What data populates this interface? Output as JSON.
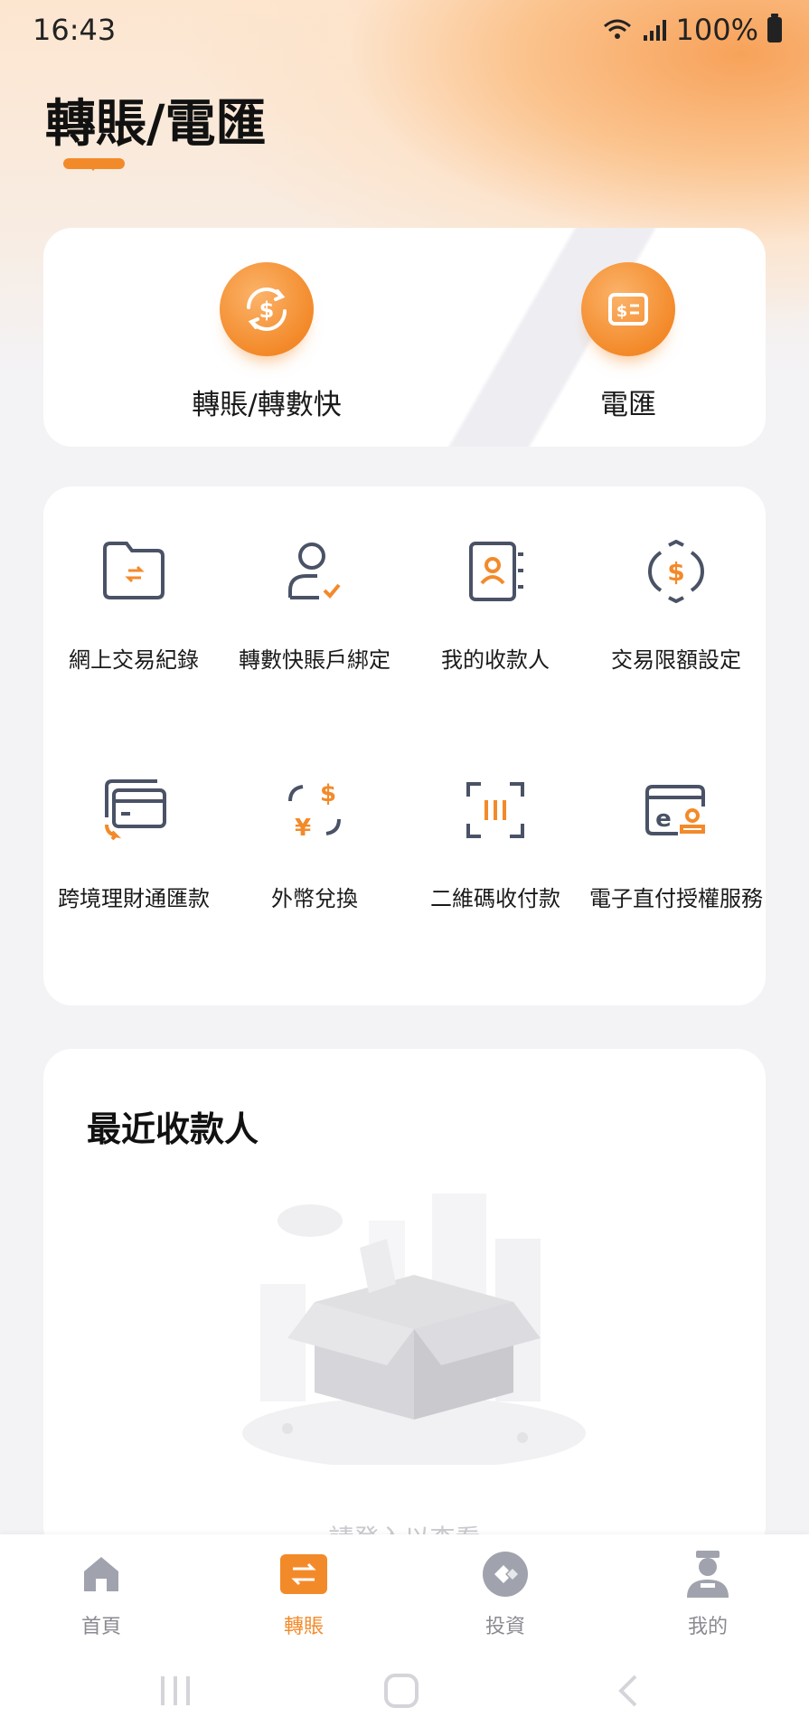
{
  "status_bar": {
    "time": "16:43",
    "battery": "100%"
  },
  "page": {
    "title": "轉賬/電匯"
  },
  "top_actions": [
    {
      "label": "轉賬/轉數快",
      "icon": "dollar-cycle-icon"
    },
    {
      "label": "電匯",
      "icon": "wire-transfer-icon"
    }
  ],
  "services": [
    {
      "label": "網上交易紀錄",
      "icon": "folder-transfer-icon"
    },
    {
      "label": "轉數快賬戶綁定",
      "icon": "user-check-icon"
    },
    {
      "label": "我的收款人",
      "icon": "contact-book-icon"
    },
    {
      "label": "交易限額設定",
      "icon": "dollar-limit-icon"
    },
    {
      "label": "跨境理財通匯款",
      "icon": "cards-icon"
    },
    {
      "label": "外幣兌換",
      "icon": "currency-exchange-icon"
    },
    {
      "label": "二維碼收付款",
      "icon": "qr-scan-icon"
    },
    {
      "label": "電子直付授權服務",
      "icon": "edda-icon"
    }
  ],
  "recent": {
    "title": "最近收款人",
    "empty_hint": "請登入以查看"
  },
  "bottom_nav": [
    {
      "label": "首頁",
      "icon": "home-icon",
      "active": false
    },
    {
      "label": "轉賬",
      "icon": "transfer-icon",
      "active": true
    },
    {
      "label": "投資",
      "icon": "invest-icon",
      "active": false
    },
    {
      "label": "我的",
      "icon": "profile-icon",
      "active": false
    }
  ],
  "colors": {
    "accent": "#f38a2a",
    "icon_dark": "#4a5266",
    "inactive": "#9a9aa4"
  }
}
